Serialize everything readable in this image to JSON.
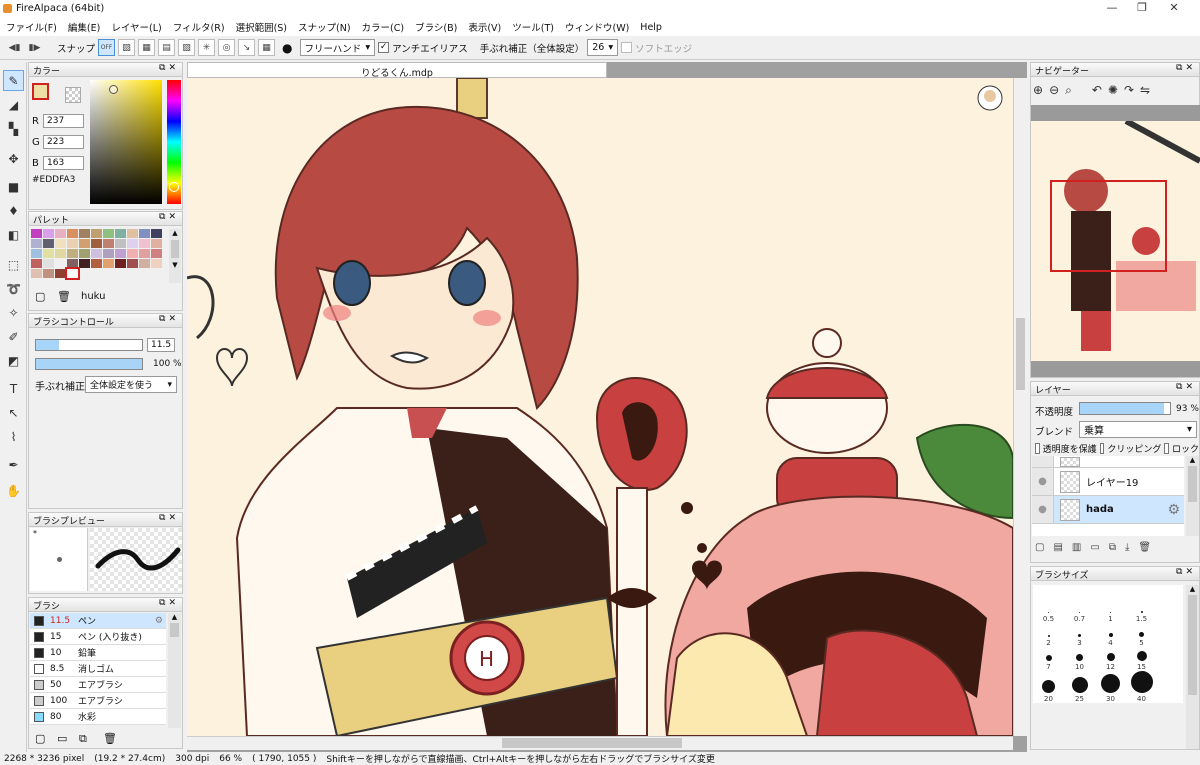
{
  "window": {
    "title": "FireAlpaca (64bit)"
  },
  "menu": [
    "ファイル(F)",
    "編集(E)",
    "レイヤー(L)",
    "フィルタ(R)",
    "選択範囲(S)",
    "スナップ(N)",
    "カラー(C)",
    "ブラシ(B)",
    "表示(V)",
    "ツール(T)",
    "ウィンドウ(W)",
    "Help"
  ],
  "toolbar": {
    "snap_label": "スナップ",
    "snap_off": "OFF",
    "mode": "フリーハンド",
    "antialias": "アンチエイリアス",
    "stabilizer_label": "手ぶれ補正（全体設定）",
    "stabilizer_value": "26",
    "soft_edge": "ソフトエッジ"
  },
  "color_panel": {
    "title": "カラー",
    "r_label": "R",
    "g_label": "G",
    "b_label": "B",
    "r": "237",
    "g": "223",
    "b": "163",
    "hex": "#EDDFA3",
    "current_color": "#EDDFA3"
  },
  "palette_panel": {
    "title": "パレット",
    "name": "huku",
    "swatches": [
      "#c040c0",
      "#d8a0e8",
      "#e8b0c0",
      "#d89060",
      "#a08060",
      "#c0a070",
      "#90c080",
      "#80b0a0",
      "#e0c0a0",
      "#8090c0",
      "#404060",
      "#b0b0d0",
      "#606070",
      "#f0e0c0",
      "#e8d0b0",
      "#d0a070",
      "#a06040",
      "#c08070",
      "#c0c0c0",
      "#e0d0f0",
      "#f0c0d0",
      "#e0b0a0",
      "#a0c0e0",
      "#e0e0a0",
      "#e0d8a0",
      "#c0b080",
      "#a0a070",
      "#d0c0e0",
      "#b0a0c0",
      "#c0a0d0",
      "#f0b0b0",
      "#e0a0a0",
      "#d08080",
      "#c06060",
      "#e0e0e0",
      "#f0f0f0",
      "#806060",
      "#402020",
      "#b06040",
      "#e0a070",
      "#702020",
      "#a05050",
      "#d0b0a0",
      "#f0d0c0",
      "#e0c0b0",
      "#c09080",
      "#904030",
      "#f8f8f8"
    ]
  },
  "brush_control": {
    "title": "ブラシコントロール",
    "size": "11.5",
    "opacity": "100 %",
    "stabilizer_label": "手ぶれ補正",
    "stabilizer_value": "全体設定を使う"
  },
  "brush_preview": {
    "title": "ブラシプレビュー"
  },
  "brush_panel": {
    "title": "ブラシ",
    "items": [
      {
        "size": "11.5",
        "name": "ペン",
        "color": "#222222"
      },
      {
        "size": "15",
        "name": "ペン (入り抜き)",
        "color": "#222222"
      },
      {
        "size": "10",
        "name": "鉛筆",
        "color": "#222222"
      },
      {
        "size": "8.5",
        "name": "消しゴム",
        "color": "#ffffff"
      },
      {
        "size": "50",
        "name": "エアブラシ",
        "color": "#cccccc"
      },
      {
        "size": "100",
        "name": "エアブラシ",
        "color": "#cccccc"
      },
      {
        "size": "80",
        "name": "水彩",
        "color": "#88ddff"
      }
    ]
  },
  "document": {
    "tab": "りどるくん.mdp"
  },
  "navigator": {
    "title": "ナビゲーター"
  },
  "layer_panel": {
    "title": "レイヤー",
    "opacity_label": "不透明度",
    "opacity": "93 %",
    "blend_label": "ブレンド",
    "blend": "乗算",
    "protect_alpha": "透明度を保護",
    "clipping": "クリッピング",
    "lock": "ロック",
    "layers": [
      {
        "name": "レイヤー19"
      },
      {
        "name": "hada"
      }
    ]
  },
  "brush_size_panel": {
    "title": "ブラシサイズ",
    "sizes": [
      "0.5",
      "0.7",
      "1",
      "1.5",
      "2",
      "3",
      "4",
      "5",
      "7",
      "10",
      "12",
      "15",
      "20",
      "25",
      "30",
      "40"
    ]
  },
  "status": {
    "size": "2268 * 3236 pixel",
    "cm": "(19.2 * 27.4cm)",
    "dpi": "300 dpi",
    "zoom": "66 %",
    "coords": "( 1790, 1055 )",
    "hint": "Shiftキーを押しながらで直線描画、Ctrl+Altキーを押しながら左右ドラッグでブラシサイズ変更"
  }
}
